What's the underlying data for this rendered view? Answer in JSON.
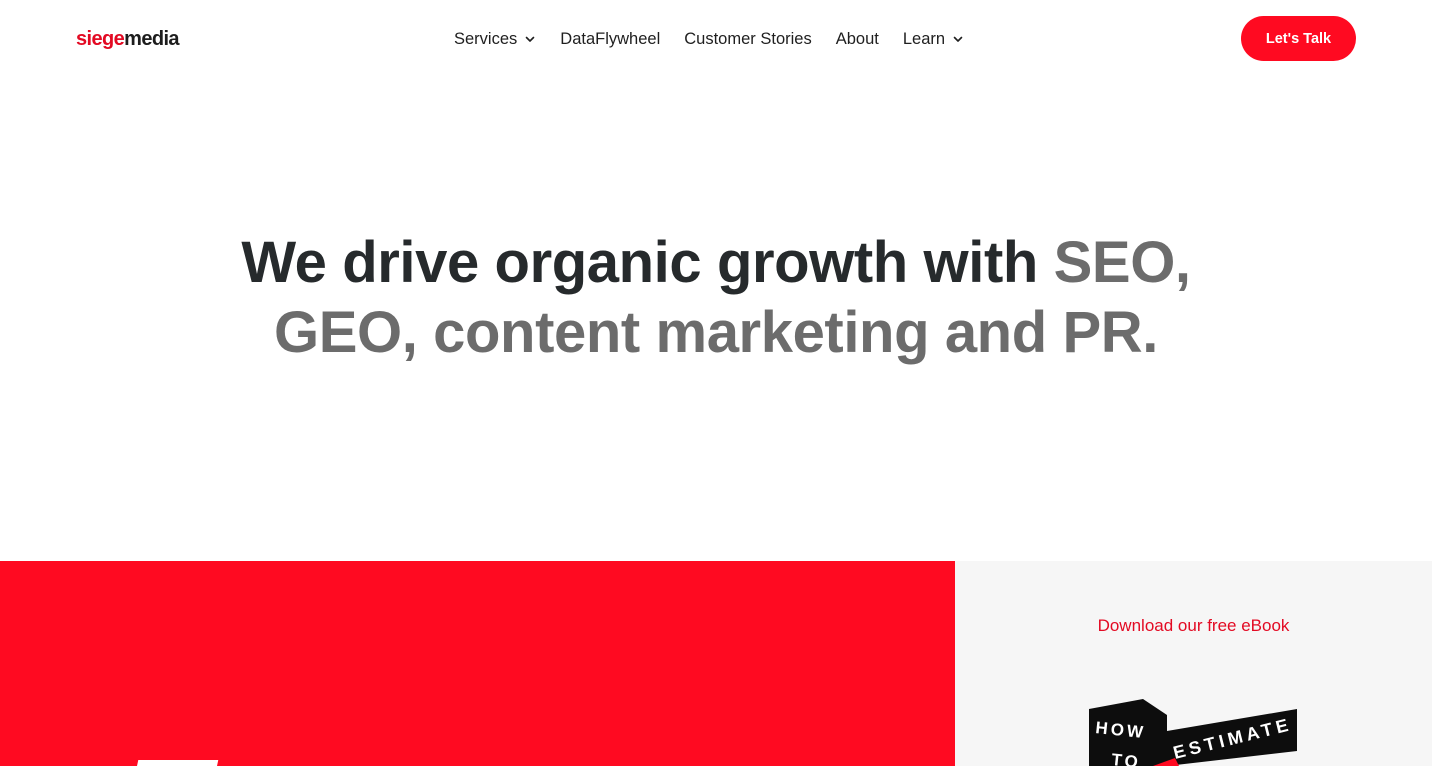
{
  "header": {
    "logo": {
      "part1": "siege",
      "part2": "media"
    },
    "nav": [
      {
        "label": "Services",
        "has_dropdown": true
      },
      {
        "label": "DataFlywheel",
        "has_dropdown": false
      },
      {
        "label": "Customer Stories",
        "has_dropdown": false
      },
      {
        "label": "About",
        "has_dropdown": false
      },
      {
        "label": "Learn",
        "has_dropdown": true
      }
    ],
    "cta_label": "Let's Talk"
  },
  "hero": {
    "line1_dark": "We drive organic growth with ",
    "line1_grey": "SEO,",
    "line2_grey": "GEO, content marketing and PR."
  },
  "ebook": {
    "link_label": "Download our free eBook",
    "cover_word1": "HOW",
    "cover_word2": "TO",
    "cover_word3": "ESTIMATE"
  },
  "colors": {
    "brand_red": "#ff0a21",
    "link_red": "#e30a23",
    "dark_text": "#262a2c",
    "grey_text": "#6c6c6c",
    "panel_grey": "#f6f6f6"
  },
  "icons": {
    "dropdown": "chevron-down-icon"
  }
}
